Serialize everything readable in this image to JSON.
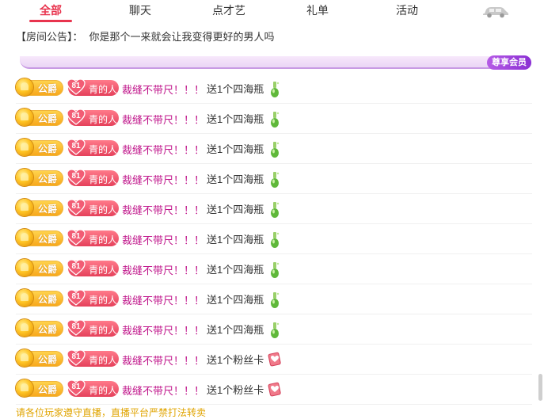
{
  "tabs": [
    "全部",
    "聊天",
    "点才艺",
    "礼单",
    "活动"
  ],
  "notice": {
    "label": "【房间公告】：",
    "text": "你是那个一来就会让我变得更好的男人吗"
  },
  "banner": {
    "vip_label": "尊享会员"
  },
  "messages": [
    {
      "rank": "公爵",
      "fan_level": "81",
      "fan_name": "青的人",
      "user": "裁缝不带尺！！！",
      "gift": "送1个四海瓶",
      "gift_icon": "bottle-icon"
    },
    {
      "rank": "公爵",
      "fan_level": "81",
      "fan_name": "青的人",
      "user": "裁缝不带尺！！！",
      "gift": "送1个四海瓶",
      "gift_icon": "bottle-icon"
    },
    {
      "rank": "公爵",
      "fan_level": "81",
      "fan_name": "青的人",
      "user": "裁缝不带尺！！！",
      "gift": "送1个四海瓶",
      "gift_icon": "bottle-icon"
    },
    {
      "rank": "公爵",
      "fan_level": "81",
      "fan_name": "青的人",
      "user": "裁缝不带尺！！！",
      "gift": "送1个四海瓶",
      "gift_icon": "bottle-icon"
    },
    {
      "rank": "公爵",
      "fan_level": "81",
      "fan_name": "青的人",
      "user": "裁缝不带尺！！！",
      "gift": "送1个四海瓶",
      "gift_icon": "bottle-icon"
    },
    {
      "rank": "公爵",
      "fan_level": "81",
      "fan_name": "青的人",
      "user": "裁缝不带尺！！！",
      "gift": "送1个四海瓶",
      "gift_icon": "bottle-icon"
    },
    {
      "rank": "公爵",
      "fan_level": "81",
      "fan_name": "青的人",
      "user": "裁缝不带尺！！！",
      "gift": "送1个四海瓶",
      "gift_icon": "bottle-icon"
    },
    {
      "rank": "公爵",
      "fan_level": "81",
      "fan_name": "青的人",
      "user": "裁缝不带尺！！！",
      "gift": "送1个四海瓶",
      "gift_icon": "bottle-icon"
    },
    {
      "rank": "公爵",
      "fan_level": "81",
      "fan_name": "青的人",
      "user": "裁缝不带尺！！！",
      "gift": "送1个四海瓶",
      "gift_icon": "bottle-icon"
    },
    {
      "rank": "公爵",
      "fan_level": "81",
      "fan_name": "青的人",
      "user": "裁缝不带尺！！！",
      "gift": "送1个粉丝卡",
      "gift_icon": "fan-card-icon"
    },
    {
      "rank": "公爵",
      "fan_level": "81",
      "fan_name": "青的人",
      "user": "裁缝不带尺！！！",
      "gift": "送1个粉丝卡",
      "gift_icon": "fan-card-icon"
    }
  ],
  "bottom_text": "请各位玩家遵守直播，直播平台严禁打法转卖"
}
